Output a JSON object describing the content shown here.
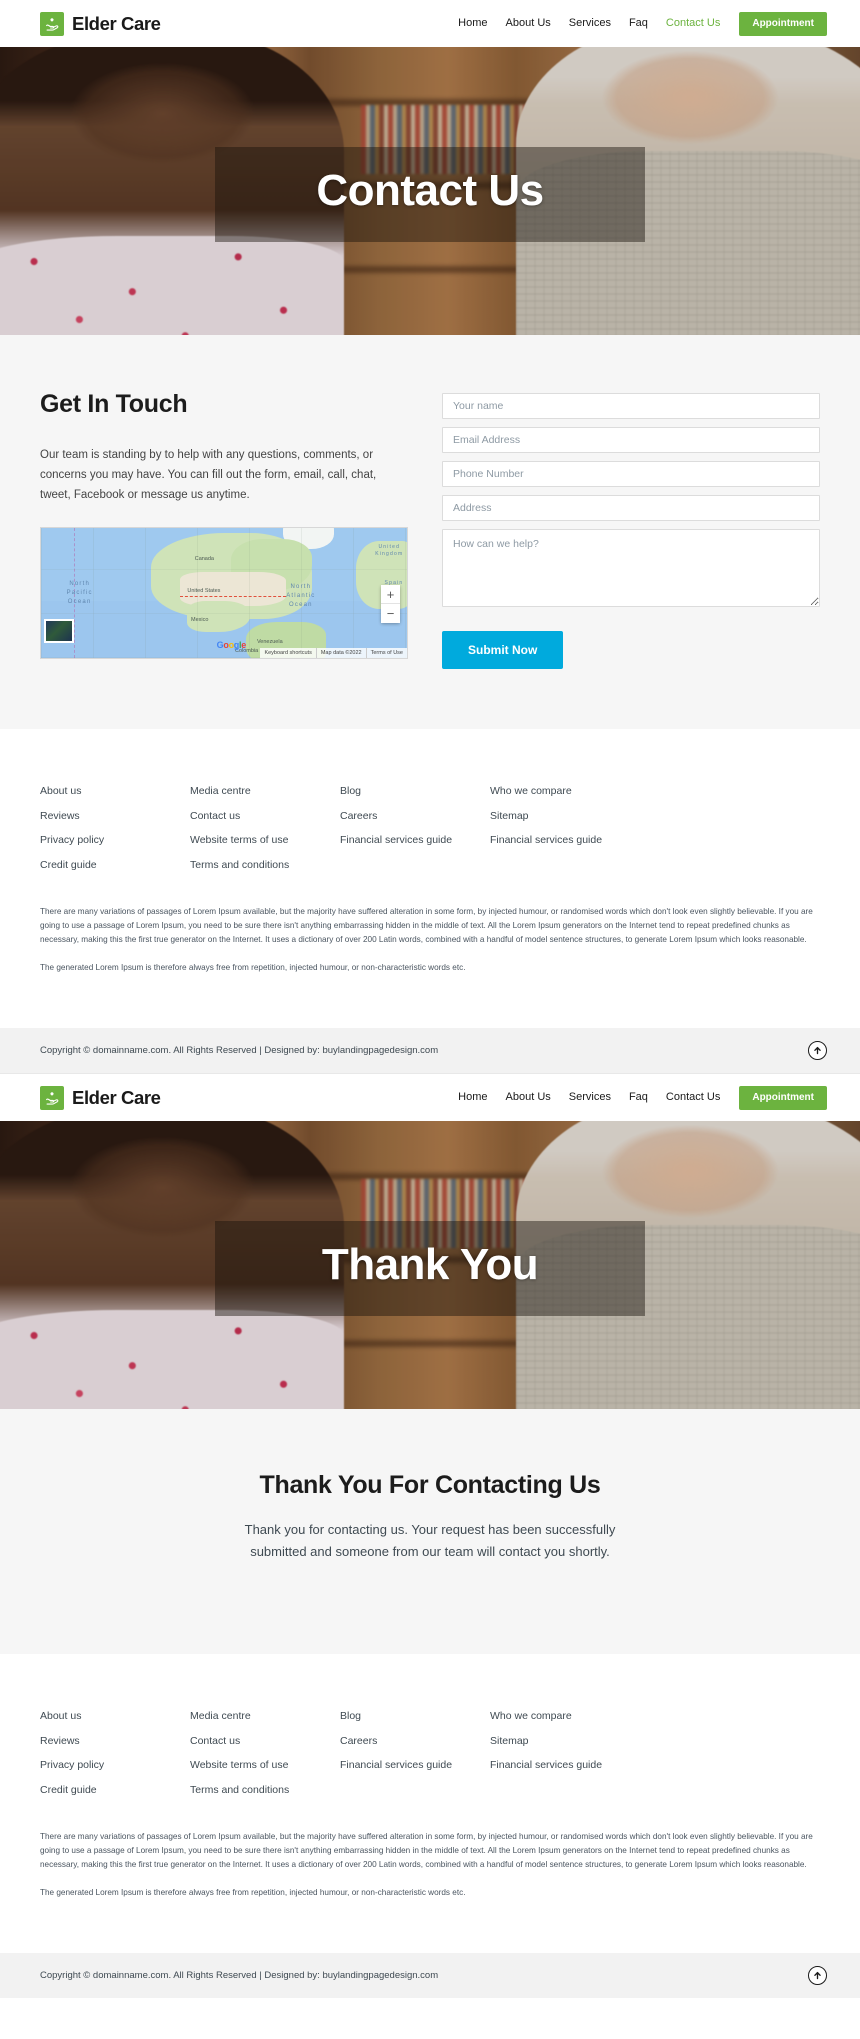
{
  "brand": {
    "name": "Elder Care",
    "logo_icon": "hand-heart-icon",
    "accent_green": "#6cb33f"
  },
  "nav": {
    "items": [
      {
        "label": "Home",
        "active": false
      },
      {
        "label": "About Us",
        "active": false
      },
      {
        "label": "Services",
        "active": false
      },
      {
        "label": "Faq",
        "active": false
      },
      {
        "label": "Contact Us",
        "active": true
      }
    ],
    "cta_label": "Appointment"
  },
  "nav2": {
    "items": [
      {
        "label": "Home",
        "active": false
      },
      {
        "label": "About Us",
        "active": false
      },
      {
        "label": "Services",
        "active": false
      },
      {
        "label": "Faq",
        "active": false
      },
      {
        "label": "Contact Us",
        "active": false
      }
    ],
    "cta_label": "Appointment"
  },
  "hero": {
    "title": "Contact Us"
  },
  "hero2": {
    "title": "Thank You"
  },
  "contact": {
    "title": "Get In Touch",
    "copy": "Our team is standing by to help with any questions, comments, or concerns you may have. You can fill out the form, email, call, chat, tweet, Facebook or message us anytime."
  },
  "form": {
    "name_placeholder": "Your name",
    "email_placeholder": "Email Address",
    "phone_placeholder": "Phone Number",
    "address_placeholder": "Address",
    "message_placeholder": "How can we help?",
    "submit_label": "Submit Now",
    "submit_color": "#00aadd"
  },
  "map": {
    "labels": {
      "canada": "Canada",
      "united_states": "United States",
      "mexico": "Mexico",
      "venezuela": "Venezuela",
      "colombia": "Colombia",
      "north_pacific_ocean": "North\nPacific\nOcean",
      "north_atlantic_ocean": "North\nAtlantic\nOcean",
      "united_kingdom": "United\nKingdom",
      "spain": "Spain"
    },
    "provider": "Google",
    "zoom_in": "+",
    "zoom_out": "−",
    "attribution": [
      "Keyboard shortcuts",
      "Map data ©2022",
      "Terms of Use"
    ]
  },
  "footer": {
    "columns": [
      {
        "links": [
          "About us",
          "Reviews",
          "Privacy policy",
          "Credit guide"
        ]
      },
      {
        "links": [
          "Media centre",
          "Contact us",
          "Website terms of use",
          "Terms and conditions"
        ]
      },
      {
        "links": [
          "Blog",
          "Careers",
          "Financial services guide"
        ]
      },
      {
        "links": [
          "Who we compare",
          "Sitemap",
          "Financial services guide"
        ]
      }
    ],
    "paragraph_1": "There are many variations of passages of Lorem Ipsum available, but the majority have suffered alteration in some form, by injected humour, or randomised words which don't look even slightly believable. If you are going to use a passage of Lorem Ipsum, you need to be sure there isn't anything embarrassing hidden in the middle of text. All the Lorem Ipsum generators on the Internet tend to repeat predefined chunks as necessary, making this the first true generator on the Internet. It uses a dictionary of over 200 Latin words, combined with a handful of model sentence structures, to generate Lorem Ipsum which looks reasonable.",
    "paragraph_2": "The generated Lorem Ipsum is therefore always free from repetition, injected humour, or non-characteristic words etc.",
    "copyright": "Copyright © domainname.com. All Rights Reserved | Designed by: buylandingpagedesign.com",
    "to_top_icon": "arrow-up-circle-icon"
  },
  "thanks": {
    "title": "Thank You For Contacting Us",
    "copy": "Thank you for contacting us. Your request has been successfully submitted and someone from our team will contact you shortly."
  }
}
